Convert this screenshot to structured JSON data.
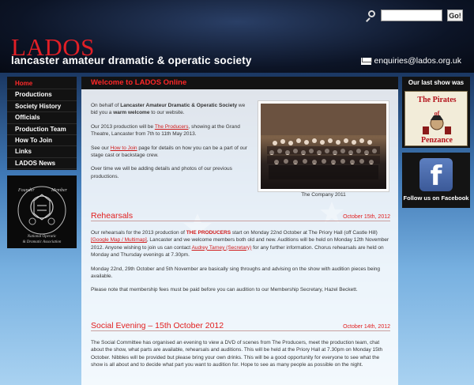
{
  "header": {
    "site_name": "LADOS",
    "tagline": "lancaster amateur dramatic & operatic society",
    "search_placeholder": "",
    "search_button": "Go!",
    "email": "enquiries@lados.org.uk"
  },
  "nav": {
    "items": [
      {
        "label": "Home",
        "active": true
      },
      {
        "label": "Productions"
      },
      {
        "label": "Society History"
      },
      {
        "label": "Officials"
      },
      {
        "label": "Production Team"
      },
      {
        "label": "How To Join"
      },
      {
        "label": "Links"
      },
      {
        "label": "LADOS News"
      }
    ]
  },
  "badge": {
    "top_left": "Founder",
    "top_right": "Member",
    "bottom_line1": "National Operatic",
    "bottom_line2": "& Dramatic Association"
  },
  "content": {
    "title": "Welcome to LADOS Online",
    "intro": {
      "p1_pre": "On behalf of ",
      "p1_bold1": "Lancaster Amateur Dramatic & Operatic Society",
      "p1_mid": " we bid you a ",
      "p1_bold2": "warm welcome",
      "p1_post": " to our website.",
      "p2_pre": "Our 2013 production will be ",
      "p2_link": "The Producers",
      "p2_post": ", showing at the Grand Theatre, Lancaster from 7th to 11th May 2013.",
      "p3_pre": "See our ",
      "p3_link": "How to Join",
      "p3_post": " page for details on how you can be a part of our stage cast or backstage crew.",
      "p4": "Over time we will be adding details and photos of our previous productions."
    },
    "photo_caption": "The Company 2011",
    "rehearsals": {
      "title": "Rehearsals",
      "date": "October 15th, 2012",
      "p1_a": "Our rehearsals for the 2013 production of ",
      "p1_bold": "THE PRODUCERS",
      "p1_b": " start on Monday 22nd October at The Priory Hall (off Castle Hill) ",
      "p1_link1": "[Google Map / Multimap]",
      "p1_c": ", Lancaster and we welcome members both old and new.    Auditions will be  held on Monday 12th November 2012.  Anyone wishing to join us can contact ",
      "p1_link2": "Audrey Tarney (Secretary)",
      "p1_d": " for any further information.  Chorus rehearsals are held on Monday and Thursday evenings at 7.30pm.",
      "p2": "Monday 22nd, 29th October and 5th November are basically sing throughs and advising on the show with audition pieces being available.",
      "p3": "Please note that membership fees must be paid before you can audition to our Membership Secretary, Hazel Beckett."
    },
    "social": {
      "title": "Social Evening – 15th October 2012",
      "date": "October 14th, 2012",
      "p1": "The Social Committee has organised an evening to view a DVD of scenes from The Producers, meet the production team, chat about the show, what parts are available, rehearsals and auditions. This will be held at the Priory Hall at 7.30pm on Monday 15th October. Nibbles will be provided but please bring your own drinks.  This will be a good opportunity for everyone to see what the show is all about and to decide what part you want to audition for. Hope to see as many people as possible on the night."
    }
  },
  "right": {
    "last_show_title": "Our last show was",
    "poster_line1": "The Pirates",
    "poster_line2": "of",
    "poster_line3": "Penzance",
    "facebook_label": "Follow us on Facebook",
    "facebook_glyph": "f"
  }
}
